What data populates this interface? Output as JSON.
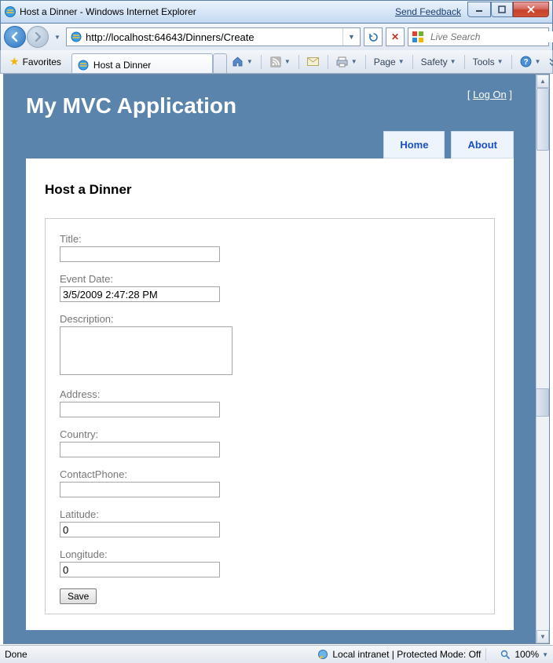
{
  "window": {
    "title": "Host a Dinner - Windows Internet Explorer",
    "feedback": "Send Feedback"
  },
  "nav": {
    "url": "http://localhost:64643/Dinners/Create",
    "search_placeholder": "Live Search"
  },
  "favorites": {
    "label": "Favorites"
  },
  "tab": {
    "title": "Host a Dinner"
  },
  "toolbar": {
    "page": "Page",
    "safety": "Safety",
    "tools": "Tools"
  },
  "app": {
    "logon_label": "Log On",
    "title": "My MVC Application",
    "menu": {
      "home": "Home",
      "about": "About"
    }
  },
  "form": {
    "heading": "Host a Dinner",
    "fields": {
      "title": {
        "label": "Title:",
        "value": ""
      },
      "eventdate": {
        "label": "Event Date:",
        "value": "3/5/2009 2:47:28 PM"
      },
      "description": {
        "label": "Description:",
        "value": ""
      },
      "address": {
        "label": "Address:",
        "value": ""
      },
      "country": {
        "label": "Country:",
        "value": ""
      },
      "contactphone": {
        "label": "ContactPhone:",
        "value": ""
      },
      "latitude": {
        "label": "Latitude:",
        "value": "0"
      },
      "longitude": {
        "label": "Longitude:",
        "value": "0"
      }
    },
    "save": "Save"
  },
  "status": {
    "left": "Done",
    "zone": "Local intranet | Protected Mode: Off",
    "zoom": "100%"
  }
}
